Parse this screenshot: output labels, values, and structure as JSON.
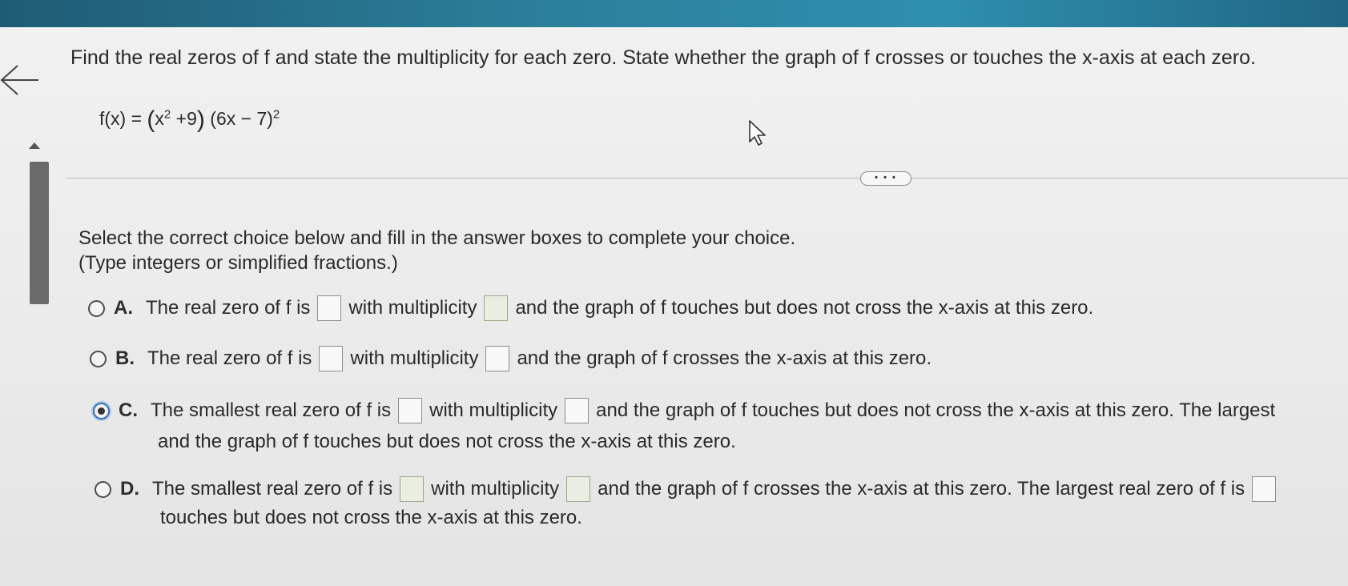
{
  "question": {
    "prompt": "Find the real zeros of f and state the multiplicity for each zero. State whether the graph of f crosses or touches the x-axis at each zero.",
    "formula": {
      "lhs": "f(x) = ",
      "factor1": "x",
      "factor1_exp": "2",
      "factor1_rest": " +9",
      "factor2": " (6x − 7)",
      "factor2_exp": "2"
    }
  },
  "more_button": "• • •",
  "instructions": {
    "line1": "Select the correct choice below and fill in the answer boxes to complete your choice.",
    "line2": "(Type integers or simplified fractions.)"
  },
  "options": [
    {
      "letter": "A.",
      "selected": false,
      "text1": "The real zero of f is",
      "text2": "with multiplicity",
      "text3": "and the graph of f touches but does not cross the x-axis at this zero."
    },
    {
      "letter": "B.",
      "selected": false,
      "text1": "The real zero of f is",
      "text2": "with multiplicity",
      "text3": "and the graph of f crosses the x-axis at this zero."
    },
    {
      "letter": "C.",
      "selected": true,
      "text1": "The smallest real zero of f is",
      "text2": "with multiplicity",
      "text3": "and the graph of f touches but does not cross the x-axis at this zero. The largest",
      "line2": "and the graph of f touches but does not cross the x-axis at this zero."
    },
    {
      "letter": "D.",
      "selected": false,
      "text1": "The smallest real zero of f is",
      "text2": "with multiplicity",
      "text3": "and the graph of f crosses the x-axis at this zero. The largest real zero of f is",
      "line2": "touches but does not cross the x-axis at this zero."
    }
  ]
}
